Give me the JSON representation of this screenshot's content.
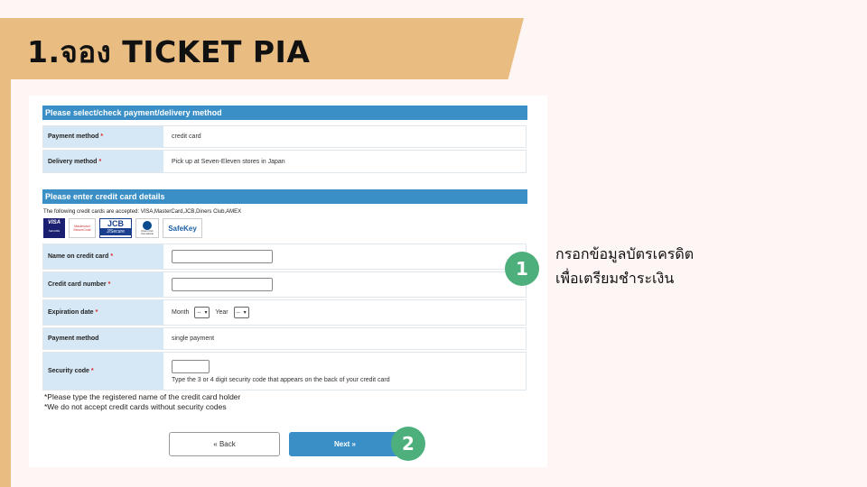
{
  "banner": {
    "title": "1.จอง TICKET PIA"
  },
  "section1": {
    "heading": "Please select/check payment/delivery method",
    "rows": [
      {
        "label": "Payment method",
        "required": "*",
        "value": "credit card"
      },
      {
        "label": "Delivery method",
        "required": "*",
        "value": "Pick up at Seven-Eleven stores in Japan"
      }
    ]
  },
  "section2": {
    "heading": "Please enter credit card details",
    "accepted_note": "The following credit cards are accepted: VISA,MasterCard,JCB,Diners Club,AMEX",
    "logos": {
      "visa": "VISA",
      "visa_sub": "SECURE",
      "mastercard": "Mastercard SecureCode",
      "jcb": "JCB",
      "jcb_sub": "J/Secure",
      "diners": "Diners Club International",
      "safekey": "SafeKey"
    },
    "name": {
      "label": "Name on credit card",
      "required": "*"
    },
    "number": {
      "label": "Credit card number",
      "required": "*"
    },
    "expiry": {
      "label": "Expiration date",
      "required": "*",
      "month_label": "Month",
      "month_value": "--",
      "year_label": "Year",
      "year_value": "--"
    },
    "payment": {
      "label": "Payment method",
      "value": "single payment"
    },
    "security": {
      "label": "Security code",
      "required": "*",
      "help": "Type the 3 or 4 digit security code that appears on the back of your credit card"
    }
  },
  "notes": [
    "*Please type the registered name of the credit card holder",
    "*We do not accept credit cards without security codes"
  ],
  "buttons": {
    "back": "« Back",
    "next": "Next »"
  },
  "steps": {
    "one": "1",
    "two": "2"
  },
  "annotation": {
    "line1": "กรอกข้อมูลบัตรเครดิต",
    "line2": "เพื่อเตรียมชำระเงิน"
  },
  "colors": {
    "banner": "#e9bc82",
    "header": "#3a8fc7",
    "label_bg": "#d6e8f5",
    "step": "#4daf7c"
  }
}
